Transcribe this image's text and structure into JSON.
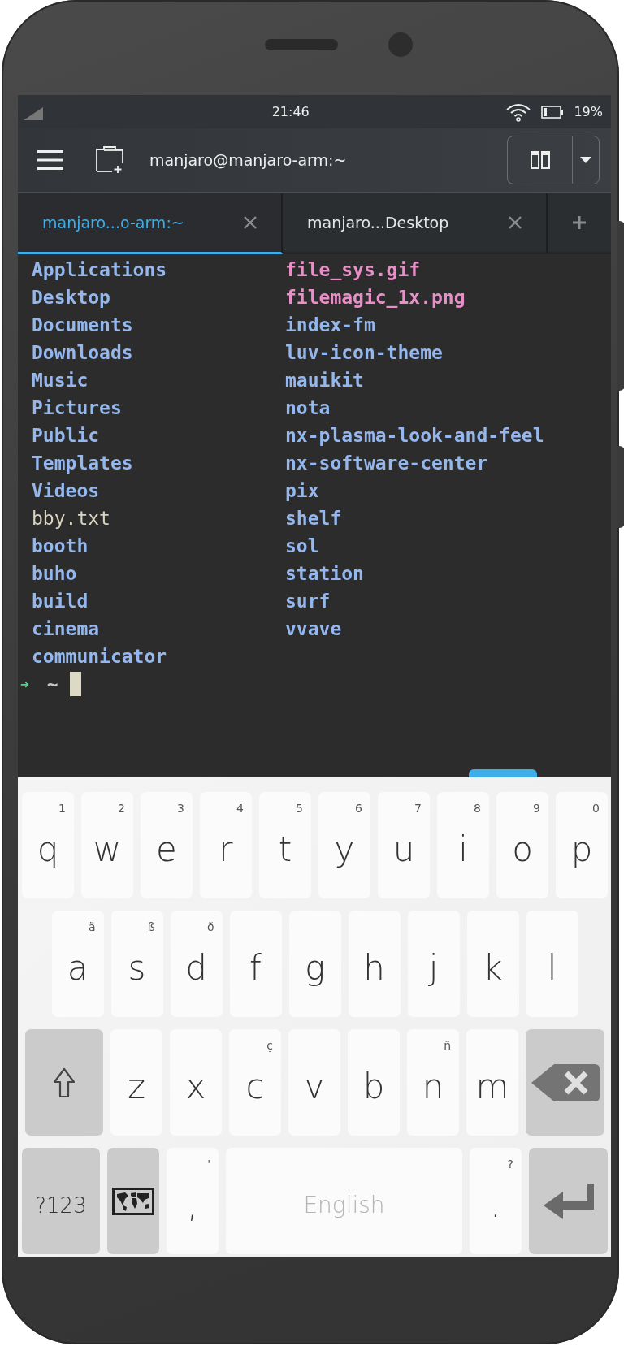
{
  "status_bar": {
    "time": "21:46",
    "battery": "19%"
  },
  "toolbar": {
    "title": "manjaro@manjaro-arm:~"
  },
  "tabs": [
    {
      "label": "manjaro...o-arm:~",
      "selected": true
    },
    {
      "label": "manjaro...Desktop",
      "selected": false
    }
  ],
  "terminal": {
    "columns": [
      {
        "entries": [
          {
            "name": "Applications",
            "kind": "dir"
          },
          {
            "name": "Desktop",
            "kind": "dir"
          },
          {
            "name": "Documents",
            "kind": "dir"
          },
          {
            "name": "Downloads",
            "kind": "dir"
          },
          {
            "name": "Music",
            "kind": "dir"
          },
          {
            "name": "Pictures",
            "kind": "dir"
          },
          {
            "name": "Public",
            "kind": "dir"
          },
          {
            "name": "Templates",
            "kind": "dir"
          },
          {
            "name": "Videos",
            "kind": "dir"
          },
          {
            "name": "bby.txt",
            "kind": "file"
          },
          {
            "name": "booth",
            "kind": "dir"
          },
          {
            "name": "buho",
            "kind": "dir"
          },
          {
            "name": "build",
            "kind": "dir"
          },
          {
            "name": "cinema",
            "kind": "dir"
          },
          {
            "name": "communicator",
            "kind": "dir"
          }
        ]
      },
      {
        "entries": [
          {
            "name": "file_sys.gif",
            "kind": "image"
          },
          {
            "name": "filemagic_1x.png",
            "kind": "image"
          },
          {
            "name": "index-fm",
            "kind": "dir"
          },
          {
            "name": "luv-icon-theme",
            "kind": "dir"
          },
          {
            "name": "mauikit",
            "kind": "dir"
          },
          {
            "name": "nota",
            "kind": "dir"
          },
          {
            "name": "nx-plasma-look-and-feel",
            "kind": "dir"
          },
          {
            "name": "nx-software-center",
            "kind": "dir"
          },
          {
            "name": "pix",
            "kind": "dir"
          },
          {
            "name": "shelf",
            "kind": "dir"
          },
          {
            "name": "sol",
            "kind": "dir"
          },
          {
            "name": "station",
            "kind": "dir"
          },
          {
            "name": "surf",
            "kind": "dir"
          },
          {
            "name": "vvave",
            "kind": "dir"
          }
        ]
      }
    ],
    "prompt": {
      "arrow": "➜",
      "path": "~"
    }
  },
  "keyboard": {
    "rows": [
      {
        "keys": [
          {
            "kind": "letter",
            "label": "q",
            "hint": "1"
          },
          {
            "kind": "letter",
            "label": "w",
            "hint": "2"
          },
          {
            "kind": "letter",
            "label": "e",
            "hint": "3"
          },
          {
            "kind": "letter",
            "label": "r",
            "hint": "4"
          },
          {
            "kind": "letter",
            "label": "t",
            "hint": "5"
          },
          {
            "kind": "letter",
            "label": "y",
            "hint": "6"
          },
          {
            "kind": "letter",
            "label": "u",
            "hint": "7"
          },
          {
            "kind": "letter",
            "label": "i",
            "hint": "8"
          },
          {
            "kind": "letter",
            "label": "o",
            "hint": "9"
          },
          {
            "kind": "letter",
            "label": "p",
            "hint": "0"
          }
        ]
      },
      {
        "keys": [
          {
            "kind": "letter",
            "label": "a",
            "hint": "ä"
          },
          {
            "kind": "letter",
            "label": "s",
            "hint": "ß"
          },
          {
            "kind": "letter",
            "label": "d",
            "hint": "ð"
          },
          {
            "kind": "letter",
            "label": "f"
          },
          {
            "kind": "letter",
            "label": "g"
          },
          {
            "kind": "letter",
            "label": "h"
          },
          {
            "kind": "letter",
            "label": "j"
          },
          {
            "kind": "letter",
            "label": "k"
          },
          {
            "kind": "letter",
            "label": "l"
          }
        ]
      },
      {
        "keys": [
          {
            "kind": "shift"
          },
          {
            "kind": "letter",
            "label": "z"
          },
          {
            "kind": "letter",
            "label": "x"
          },
          {
            "kind": "letter",
            "label": "c",
            "hint": "ç"
          },
          {
            "kind": "letter",
            "label": "v"
          },
          {
            "kind": "letter",
            "label": "b"
          },
          {
            "kind": "letter",
            "label": "n",
            "hint": "ñ"
          },
          {
            "kind": "letter",
            "label": "m"
          },
          {
            "kind": "backspace"
          }
        ]
      },
      {
        "keys": [
          {
            "kind": "symbols",
            "label": "?123"
          },
          {
            "kind": "language"
          },
          {
            "kind": "letter",
            "label": ",",
            "hint": "'"
          },
          {
            "kind": "space",
            "label": "English"
          },
          {
            "kind": "letter",
            "label": ".",
            "hint": "?"
          },
          {
            "kind": "enter"
          }
        ]
      }
    ]
  }
}
